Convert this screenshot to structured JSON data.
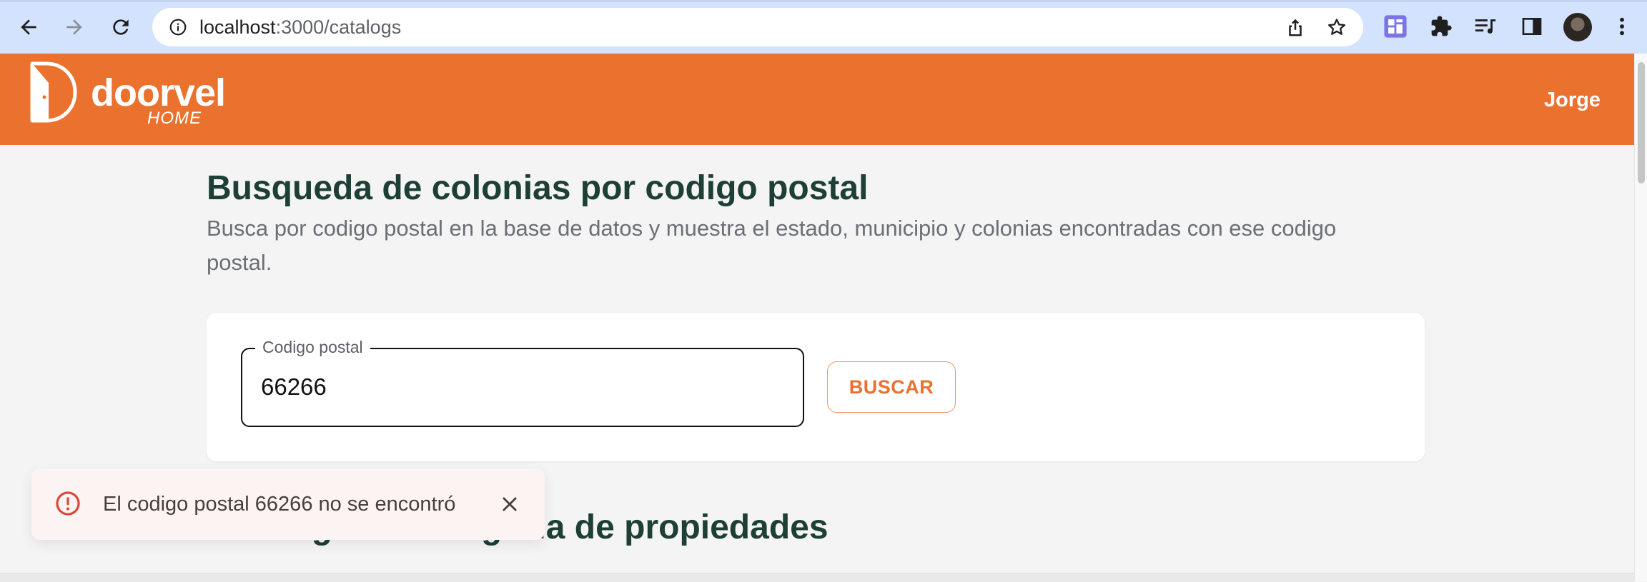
{
  "browser": {
    "url_host": "localhost",
    "url_path": ":3000/catalogs"
  },
  "header": {
    "brand_name": "doorvel",
    "brand_sub": "HOME",
    "user_name": "Jorge",
    "color": "#eb712f"
  },
  "main": {
    "title": "Busqueda de colonias por codigo postal",
    "description": "Busca por codigo postal en la base de datos y muestra el estado, municipio y colonias encontradas con ese codigo postal.",
    "search": {
      "label": "Codigo postal",
      "value": "66266",
      "button_label": "BUSCAR"
    },
    "section_title": "Catalogo de categoria de propiedades"
  },
  "snackbar": {
    "message": "El codigo postal 66266 no se encontró",
    "type": "error"
  },
  "icons": {
    "back": "arrow-left-icon",
    "forward": "arrow-right-icon",
    "reload": "reload-icon",
    "info": "info-icon",
    "share": "share-icon",
    "bookmark": "star-icon",
    "extension": "puzzle-icon",
    "reading_list": "reading-list-icon",
    "side_panel": "side-panel-icon",
    "menu": "kebab-menu-icon",
    "error": "error-icon",
    "close": "close-icon"
  }
}
